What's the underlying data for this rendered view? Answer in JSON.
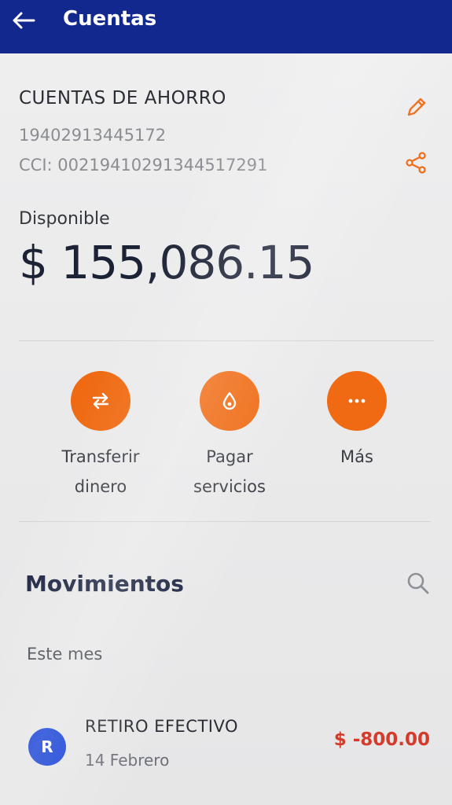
{
  "header": {
    "title": "Cuentas",
    "back_icon": "arrow-left-icon",
    "bg_color": "#13288f"
  },
  "account": {
    "type": "CUENTAS DE AHORRO",
    "number": "19402913445172",
    "cci": "CCI: 00219410291344517291",
    "edit_icon": "pencil-icon",
    "share_icon": "share-icon"
  },
  "balance": {
    "label": "Disponible",
    "amount": "$ 155,086.15"
  },
  "actions": [
    {
      "line1": "Transferir",
      "line2": "dinero",
      "icon": "transfer-arrows-icon"
    },
    {
      "line1": "Pagar",
      "line2": "servicios",
      "icon": "drop-icon"
    },
    {
      "line1": "Más",
      "line2": "",
      "icon": "more-dots-icon"
    }
  ],
  "accent_color": "#ef6a12",
  "movements": {
    "title": "Movimientos",
    "search_icon": "search-icon",
    "period": "Este mes",
    "items": [
      {
        "avatar": "R",
        "title": "RETIRO EFECTIVO",
        "date": "14 Febrero",
        "amount": "$ -800.00",
        "amount_color": "#d63a2a"
      }
    ]
  }
}
